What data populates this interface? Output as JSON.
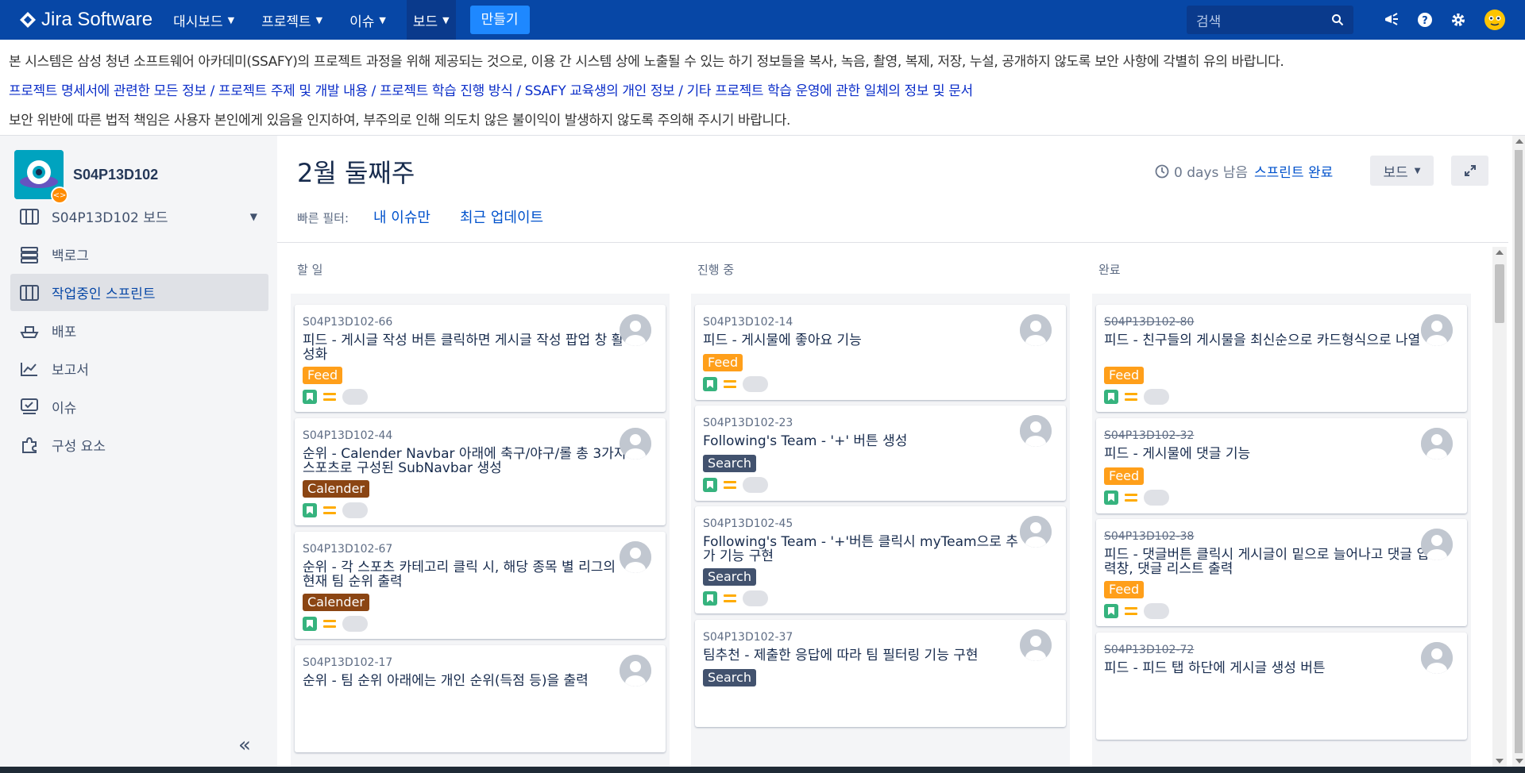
{
  "topnav": {
    "logo_text": "Jira Software",
    "items": [
      {
        "label": "대시보드"
      },
      {
        "label": "프로젝트"
      },
      {
        "label": "이슈"
      },
      {
        "label": "보드"
      }
    ],
    "create_label": "만들기",
    "search_placeholder": "검색",
    "icons": [
      "megaphone-icon",
      "help-icon",
      "settings-icon",
      "user-avatar"
    ]
  },
  "notice": {
    "line1": "본 시스템은 삼성 청년 소프트웨어 아카데미(SSAFY)의 프로젝트 과정을 위해 제공되는 것으로, 이용 간 시스템 상에 노출될 수 있는 하기 정보들을 복사, 녹음, 촬영, 복제, 저장, 누설, 공개하지 않도록 보안 사항에 각별히 유의 바랍니다.",
    "line2": "프로젝트 명세서에 관련한 모든 정보 / 프로젝트 주제 및 개발 내용 / 프로젝트 학습 진행 방식 / SSAFY 교육생의 개인 정보 / 기타 프로젝트 학습 운영에 관한 일체의 정보 및 문서",
    "line3": "보안 위반에 따른 법적 책임은 사용자 본인에게 있음을 인지하여, 부주의로 인해 의도치 않은 불이익이 발생하지 않도록 주의해 주시기 바랍니다."
  },
  "sidebar": {
    "project_name": "S04P13D102",
    "items": [
      {
        "label": "S04P13D102 보드"
      },
      {
        "label": "백로그"
      },
      {
        "label": "작업중인 스프린트"
      },
      {
        "label": "배포"
      },
      {
        "label": "보고서"
      },
      {
        "label": "이슈"
      },
      {
        "label": "구성 요소"
      }
    ],
    "collapse_label": "«"
  },
  "board": {
    "sprint_title": "2월 둘째주",
    "days_left": "0 days 남음",
    "complete_sprint": "스프린트 완료",
    "board_menu": "보드",
    "quick_filters_label": "빠른 필터:",
    "quick_filters": [
      "내 이슈만",
      "최근 업데이트"
    ],
    "columns": [
      {
        "title": "할 일",
        "cards": [
          {
            "key": "S04P13D102-66",
            "summary": "피드 - 게시글 작성 버튼 클릭하면 게시글 작성 팝업 창 활성화",
            "epic": "Feed"
          },
          {
            "key": "S04P13D102-44",
            "summary": "순위 - Calender Navbar 아래에 축구/야구/롤 총 3가지 스포츠로 구성된 SubNavbar 생성",
            "epic": "Calender"
          },
          {
            "key": "S04P13D102-67",
            "summary": "순위 - 각 스포츠 카테고리 클릭 시, 해당 종목 별 리그의 현재 팀 순위 출력",
            "epic": "Calender"
          },
          {
            "key": "S04P13D102-17",
            "summary": "순위 - 팀 순위 아래에는 개인 순위(득점 등)을 출력",
            "epic": ""
          }
        ]
      },
      {
        "title": "진행 중",
        "cards": [
          {
            "key": "S04P13D102-14",
            "summary": "피드 - 게시물에 좋아요 기능",
            "epic": "Feed"
          },
          {
            "key": "S04P13D102-23",
            "summary": "Following's Team - '+' 버튼 생성",
            "epic": "Search"
          },
          {
            "key": "S04P13D102-45",
            "summary": "Following's Team - '+'버튼 클릭시 myTeam으로 추가 기능 구현",
            "epic": "Search"
          },
          {
            "key": "S04P13D102-37",
            "summary": "팀추천 - 제출한 응답에 따라 팀 필터링 기능 구현",
            "epic": "Search"
          }
        ]
      },
      {
        "title": "완료",
        "cards": [
          {
            "key": "S04P13D102-80",
            "summary": "피드 - 친구들의 게시물을 최신순으로 카드형식으로 나열",
            "epic": "Feed"
          },
          {
            "key": "S04P13D102-32",
            "summary": "피드 - 게시물에 댓글 기능",
            "epic": "Feed"
          },
          {
            "key": "S04P13D102-38",
            "summary": "피드 - 댓글버튼 클릭시 게시글이 밑으로 늘어나고 댓글 입력창, 댓글 리스트 출력",
            "epic": "Feed"
          },
          {
            "key": "S04P13D102-72",
            "summary": "피드 - 피드 탭 하단에 게시글 생성 버튼",
            "epic": ""
          }
        ]
      }
    ]
  },
  "colors": {
    "nav_bg": "#0747a6",
    "create_btn": "#1e88ff",
    "epic_feed": "#ff9f1a",
    "epic_calender": "#8b4513",
    "epic_search": "#42526e",
    "link": "#0052cc"
  }
}
